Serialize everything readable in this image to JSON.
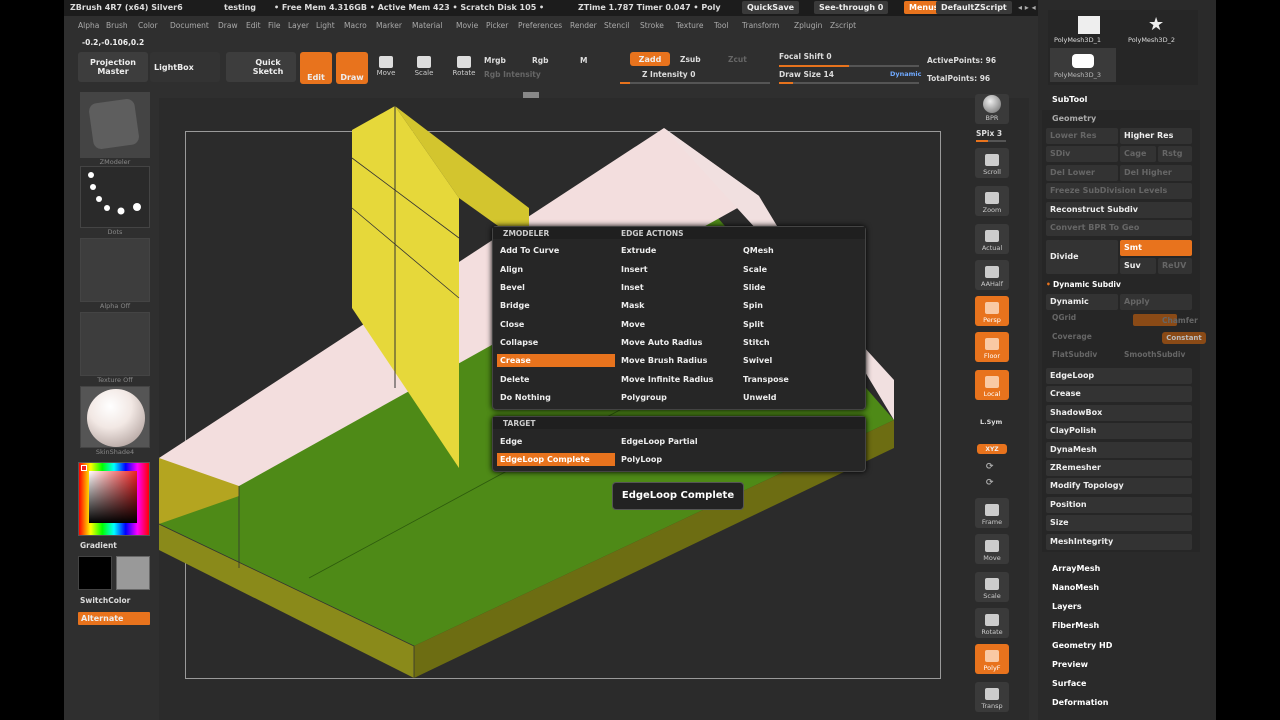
{
  "titlebar": {
    "app": "ZBrush 4R7 (x64) Silver6",
    "doc": "testing",
    "mem": "• Free Mem 4.316GB • Active Mem 423 • Scratch Disk 105 •",
    "timer": "ZTime 1.787 Timer 0.047 • Poly",
    "quicksave": "QuickSave",
    "seethrough": "See-through 0",
    "menus": "Menus",
    "script": "DefaultZScript"
  },
  "menubar": [
    "Alpha",
    "Brush",
    "Color",
    "Document",
    "Draw",
    "Edit",
    "File",
    "Layer",
    "Light",
    "Macro",
    "Marker",
    "Material",
    "Movie",
    "Picker",
    "Preferences",
    "Render",
    "Stencil",
    "Stroke",
    "Texture",
    "Tool",
    "Transform",
    "Zplugin",
    "Zscript"
  ],
  "coords": "-0.2,-0.106,0.2",
  "shelf": {
    "projection_master": "Projection Master",
    "lightbox": "LightBox",
    "quick_sketch": "Quick Sketch",
    "edit": "Edit",
    "draw": "Draw",
    "move": "Move",
    "scale": "Scale",
    "rotate": "Rotate",
    "mrgb": "Mrgb",
    "rgb": "Rgb",
    "m": "M",
    "rgb_intensity": "Rgb Intensity",
    "zadd": "Zadd",
    "zsub": "Zsub",
    "zcut": "Zcut",
    "z_intensity": "Z Intensity 0",
    "focal_shift": "Focal Shift 0",
    "draw_size": "Draw Size 14",
    "dynamic": "Dynamic",
    "active_points": "ActivePoints: 96",
    "total_points": "TotalPoints: 96"
  },
  "left": {
    "zmodeler": "ZModeler",
    "dots": "Dots",
    "alpha": "Alpha Off",
    "texture": "Texture Off",
    "material": "SkinShade4",
    "gradient": "Gradient",
    "switchcolor": "SwitchColor",
    "alternate": "Alternate"
  },
  "right_strip": {
    "bpr": "BPR",
    "spix": "SPix 3",
    "scroll": "Scroll",
    "zoom": "Zoom",
    "actual": "Actual",
    "aahalf": "AAHalf",
    "persp": "Persp",
    "floor": "Floor",
    "local": "Local",
    "lsym": "L.Sym",
    "xyz": "XYZ",
    "frame": "Frame",
    "move": "Move",
    "scale": "Scale",
    "rotate": "Rotate",
    "polyf": "PolyF",
    "transp": "Transp"
  },
  "panel": {
    "thumb1": "PolyMesh3D_1",
    "thumb2": "PolyMesh3D_2",
    "thumb3": "PolyMesh3D_3",
    "subtool": "SubTool",
    "geometry": "Geometry",
    "lower_res": "Lower Res",
    "higher_res": "Higher Res",
    "sdiv": "SDiv",
    "cage": "Cage",
    "rstg": "Rstg",
    "del_lower": "Del Lower",
    "del_higher": "Del Higher",
    "freeze": "Freeze SubDivision Levels",
    "reconstruct": "Reconstruct Subdiv",
    "convert_bpr": "Convert BPR To Geo",
    "divide": "Divide",
    "smt": "Smt",
    "suv": "Suv",
    "reuv": "ReUV",
    "dynamic_subdiv": "Dynamic Subdiv",
    "dynamic": "Dynamic",
    "apply": "Apply",
    "qgrid": "QGrid",
    "chamfer": "Chamfer",
    "coverage": "Coverage",
    "constant": "Constant",
    "flatsubdiv": "FlatSubdiv",
    "smoothsubdiv": "SmoothSubdiv",
    "items": [
      "EdgeLoop",
      "Crease",
      "ShadowBox",
      "ClayPolish",
      "DynaMesh",
      "ZRemesher",
      "Modify Topology",
      "Position",
      "Size",
      "MeshIntegrity"
    ],
    "sections": [
      "ArrayMesh",
      "NanoMesh",
      "Layers",
      "FiberMesh",
      "Geometry HD",
      "Preview",
      "Surface",
      "Deformation"
    ]
  },
  "popup": {
    "zmodeler_header": "ZMODELER",
    "edge_actions_header": "EDGE ACTIONS",
    "col1": [
      "Add To Curve",
      "Align",
      "Bevel",
      "Bridge",
      "Close",
      "Collapse",
      "Crease",
      "Delete",
      "Do Nothing"
    ],
    "col2": [
      "Extrude",
      "Insert",
      "Inset",
      "Mask",
      "Move",
      "Move Auto Radius",
      "Move Brush Radius",
      "Move Infinite Radius",
      "Polygroup"
    ],
    "col3": [
      "QMesh",
      "Scale",
      "Slide",
      "Spin",
      "Split",
      "Stitch",
      "Swivel",
      "Transpose",
      "Unweld"
    ],
    "selected_action": "Crease",
    "target_header": "TARGET",
    "targets": [
      "Edge",
      "EdgeLoop Partial",
      "EdgeLoop Complete",
      "PolyLoop"
    ],
    "selected_target": "EdgeLoop Complete"
  },
  "tooltip": "EdgeLoop Complete",
  "colors": {
    "accent": "#e8731d",
    "bg": "#2f2f2f",
    "mesh_yellow": "#e6d83a",
    "mesh_green": "#4e8a17",
    "mesh_pink": "#f3dede"
  }
}
